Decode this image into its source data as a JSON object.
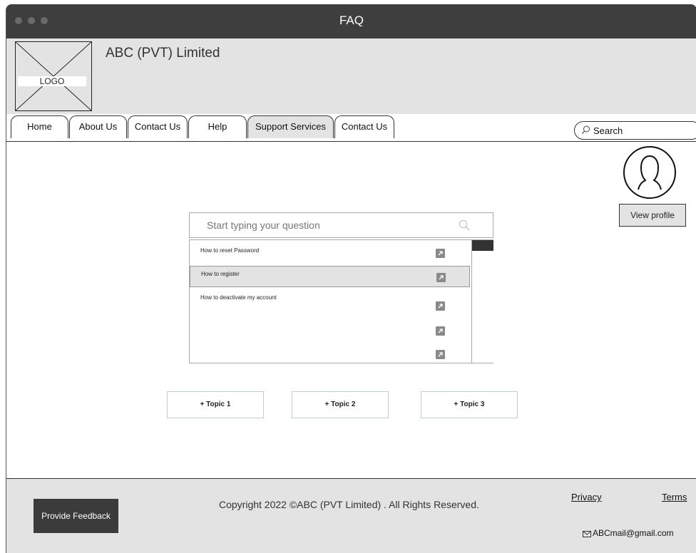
{
  "window": {
    "title": "FAQ"
  },
  "header": {
    "logo_label": "LOGO",
    "company_name": "ABC (PVT) Limited"
  },
  "nav": {
    "tabs": [
      {
        "label": "Home"
      },
      {
        "label": "About Us"
      },
      {
        "label": "Contact Us"
      },
      {
        "label": "Help"
      },
      {
        "label": "Support Services"
      },
      {
        "label": "Contact Us"
      }
    ],
    "active_tab": "Support Services",
    "search_placeholder": "Search"
  },
  "profile": {
    "view_profile_label": "View profile"
  },
  "faq": {
    "input_placeholder": "Start typing your question",
    "results": [
      {
        "label": "How to reset Password"
      },
      {
        "label": "How to register",
        "selected": true
      },
      {
        "label": "How to deactivate my account"
      },
      {
        "label": ""
      },
      {
        "label": ""
      }
    ]
  },
  "topics": [
    {
      "label": "+ Topic 1"
    },
    {
      "label": "+ Topic 2"
    },
    {
      "label": "+ Topic 3"
    }
  ],
  "footer": {
    "feedback_label": "Provide Feedback",
    "copyright": "Copyright 2022 ©ABC (PVT Limited) . All Rights Reserved.",
    "privacy_label": "Privacy",
    "terms_label": "Terms",
    "email": "ABCmail@gmail.com"
  },
  "icons": {
    "window_dots": [
      "dot-icon",
      "dot-icon",
      "dot-icon"
    ],
    "search": "search-icon",
    "avatar": "user-icon",
    "external": "external-link-icon",
    "email": "envelope-icon"
  }
}
